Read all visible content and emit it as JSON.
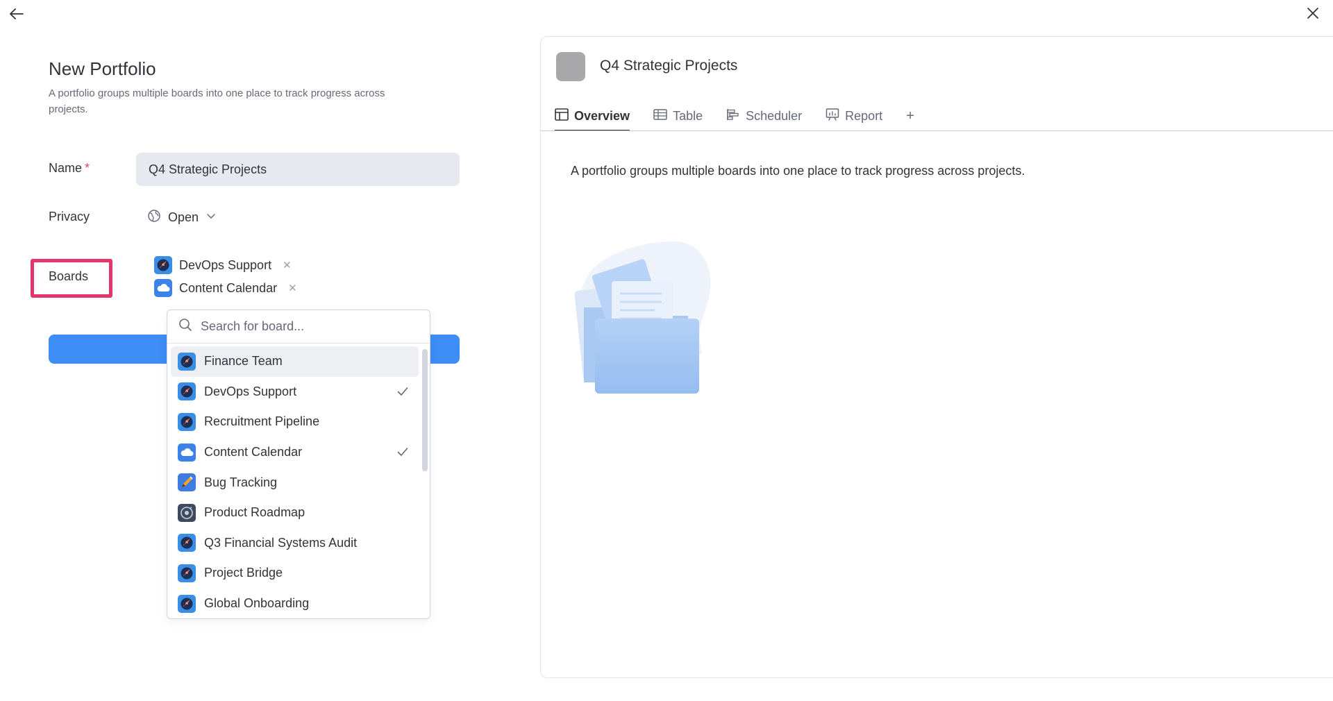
{
  "form": {
    "title": "New Portfolio",
    "description": "A portfolio groups multiple boards into one place to track progress across projects.",
    "name_label": "Name",
    "required_mark": "*",
    "name_value": "Q4 Strategic Projects",
    "privacy_label": "Privacy",
    "privacy_value": "Open",
    "boards_label": "Boards",
    "selected_boards": [
      {
        "label": "DevOps Support",
        "icon": "rocket-board-icon"
      },
      {
        "label": "Content Calendar",
        "icon": "cloud-board-icon"
      }
    ]
  },
  "dropdown": {
    "search_placeholder": "Search for board...",
    "items": [
      {
        "label": "Finance Team",
        "icon": "rocket-board-icon",
        "checked": false,
        "hovered": true
      },
      {
        "label": "DevOps Support",
        "icon": "rocket-board-icon",
        "checked": true
      },
      {
        "label": "Recruitment Pipeline",
        "icon": "rocket-board-icon",
        "checked": false
      },
      {
        "label": "Content Calendar",
        "icon": "cloud-board-icon",
        "checked": true
      },
      {
        "label": "Bug Tracking",
        "icon": "pencil-board-icon",
        "checked": false
      },
      {
        "label": "Product Roadmap",
        "icon": "disc-board-icon",
        "checked": false
      },
      {
        "label": "Q3 Financial Systems Audit",
        "icon": "rocket-board-icon",
        "checked": false
      },
      {
        "label": "Project Bridge",
        "icon": "rocket-board-icon",
        "checked": false
      },
      {
        "label": "Global Onboarding",
        "icon": "rocket-board-icon",
        "checked": false
      }
    ]
  },
  "preview": {
    "title": "Q4 Strategic Projects",
    "tabs": [
      {
        "label": "Overview",
        "icon": "overview-icon",
        "active": true
      },
      {
        "label": "Table",
        "icon": "table-icon",
        "active": false
      },
      {
        "label": "Scheduler",
        "icon": "scheduler-icon",
        "active": false
      },
      {
        "label": "Report",
        "icon": "report-icon",
        "active": false
      }
    ],
    "add_tab": "+",
    "description": "A portfolio groups multiple boards into one place to track progress across projects."
  },
  "colors": {
    "accent": "#3d8df5",
    "highlight": "#e4366b",
    "required": "#e2445c",
    "input_bg": "#e6e9ef"
  }
}
